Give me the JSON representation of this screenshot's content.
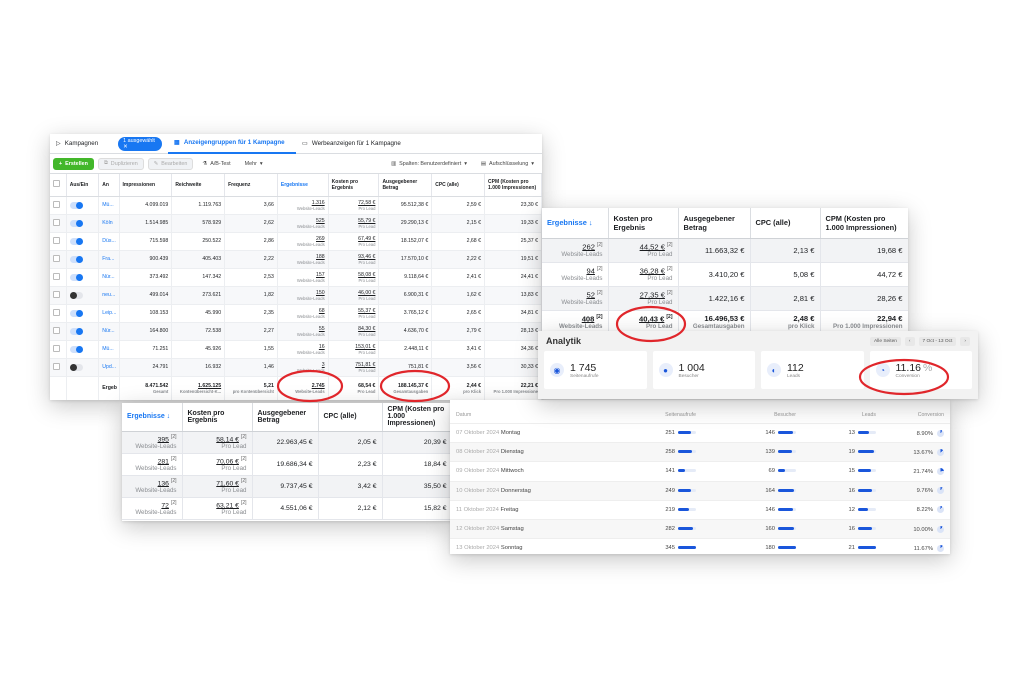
{
  "p1": {
    "tabs": {
      "campaigns": "Kampagnen",
      "selected": "1 ausgewählt",
      "adsets": "Anzeigengruppen für 1 Kampagne",
      "ads": "Werbeanzeigen für 1 Kampagne"
    },
    "toolbar": {
      "create": "Erstellen",
      "duplicate": "Duplizieren",
      "edit": "Bearbeiten",
      "abtest": "A/B-Test",
      "more": "Mehr",
      "columns": "Spalten: Benutzerdefiniert",
      "breakdown": "Aufschlüsselung"
    },
    "headers": [
      "Aus/Ein",
      "An",
      "Impressionen",
      "Reichweite",
      "Frequenz",
      "Ergebnisse",
      "Kosten pro Ergebnis",
      "Ausgegebener Betrag",
      "CPC (alle)",
      "CPM (Kosten pro 1.000 Impressionen)"
    ],
    "result_sub": "Website-Leads",
    "cost_sub": "Pro Lead",
    "rows": [
      {
        "toggle": "on",
        "name": "Mü...",
        "impr": "4.099.019",
        "reach": "1.119.763",
        "freq": "3,66",
        "res": "1.316",
        "cpr": "72,58 €",
        "spend": "95.512,38 €",
        "cpc": "2,59 €",
        "cpm": "23,30 €"
      },
      {
        "toggle": "on",
        "name": "Köln",
        "impr": "1.514.985",
        "reach": "578.929",
        "freq": "2,62",
        "res": "525",
        "cpr": "55,79 €",
        "spend": "29.290,13 €",
        "cpc": "2,15 €",
        "cpm": "19,33 €"
      },
      {
        "toggle": "on",
        "name": "Düs...",
        "impr": "715.598",
        "reach": "250.522",
        "freq": "2,86",
        "res": "269",
        "cpr": "67,49 €",
        "spend": "18.152,07 €",
        "cpc": "2,68 €",
        "cpm": "25,37 €"
      },
      {
        "toggle": "on",
        "name": "Fra...",
        "impr": "900.439",
        "reach": "405.403",
        "freq": "2,22",
        "res": "188",
        "cpr": "93,46 €",
        "spend": "17.570,10 €",
        "cpc": "2,22 €",
        "cpm": "19,51 €"
      },
      {
        "toggle": "on",
        "name": "Nür...",
        "impr": "373.492",
        "reach": "147.342",
        "freq": "2,53",
        "res": "157",
        "cpr": "58,08 €",
        "spend": "9.118,64 €",
        "cpc": "2,41 €",
        "cpm": "24,41 €"
      },
      {
        "toggle": "off",
        "name": "neu...",
        "impr": "499.014",
        "reach": "273.621",
        "freq": "1,82",
        "res": "150",
        "cpr": "46,00 €",
        "spend": "6.900,31 €",
        "cpc": "1,62 €",
        "cpm": "13,83 €"
      },
      {
        "toggle": "on",
        "name": "Leip...",
        "impr": "108.153",
        "reach": "45.990",
        "freq": "2,35",
        "res": "68",
        "cpr": "55,37 €",
        "spend": "3.765,12 €",
        "cpc": "2,65 €",
        "cpm": "34,81 €"
      },
      {
        "toggle": "on",
        "name": "Nür...",
        "impr": "164.800",
        "reach": "72.538",
        "freq": "2,27",
        "res": "55",
        "cpr": "84,30 €",
        "spend": "4.636,70 €",
        "cpc": "2,79 €",
        "cpm": "28,13 €"
      },
      {
        "toggle": "on",
        "name": "Mü...",
        "impr": "71.251",
        "reach": "45.926",
        "freq": "1,55",
        "res": "16",
        "cpr": "153,01 €",
        "spend": "2.448,11 €",
        "cpc": "3,41 €",
        "cpm": "34,36 €"
      },
      {
        "toggle": "off",
        "name": "Upd...",
        "impr": "24.791",
        "reach": "16.932",
        "freq": "1,46",
        "res": "3",
        "cpr": "751,81 €",
        "spend": "751,81 €",
        "cpc": "3,56 €",
        "cpm": "30,33 €"
      }
    ],
    "total": {
      "label": "Ergeb",
      "impr": "8.471.542",
      "impr_sub": "Gesamt",
      "reach": "1.625.125",
      "reach_sub": "Kontenübersicht-K...",
      "freq": "5,21",
      "freq_sub": "pro Kontenübersicht",
      "res": "2.745",
      "res_sub": "Website-Leads",
      "cpr": "68,54 €",
      "cpr_sub": "Pro Lead",
      "spend": "188.145,37 €",
      "spend_sub": "Gesamtausgaben",
      "cpc": "2,44 €",
      "cpc_sub": "pro Klick",
      "cpm": "22,21 €",
      "cpm_sub": "Pro 1.000 Impressione"
    }
  },
  "p2": {
    "headers": [
      "Ergebnisse ↓",
      "Kosten pro Ergebnis",
      "Ausgegebener Betrag",
      "CPC (alle)",
      "CPM (Kosten pro 1.000 Impressionen)"
    ],
    "rows": [
      {
        "res": "262",
        "cpr": "44,52 €",
        "spend": "11.663,32 €",
        "cpc": "2,13 €",
        "cpm": "19,68 €"
      },
      {
        "res": "94",
        "cpr": "36,28 €",
        "spend": "3.410,20 €",
        "cpc": "5,08 €",
        "cpm": "44,72 €"
      },
      {
        "res": "52",
        "cpr": "27,35 €",
        "spend": "1.422,16 €",
        "cpc": "2,81 €",
        "cpm": "28,26 €"
      }
    ],
    "total": {
      "res": "408",
      "cpr": "40,43 €",
      "spend": "16.496,53 €",
      "spend_sub": "Gesamtausgaben",
      "cpc": "2,48 €",
      "cpc_sub": "pro Klick",
      "cpm": "22,94 €",
      "cpm_sub": "Pro 1.000 Impressionen"
    },
    "note": "[2]",
    "res_sub": "Website-Leads",
    "cost_sub": "Pro Lead"
  },
  "p3": {
    "headers": [
      "Ergebnisse ↓",
      "Kosten pro Ergebnis",
      "Ausgegebener Betrag",
      "CPC (alle)",
      "CPM (Kosten pro 1.000 Impressionen)"
    ],
    "rows": [
      {
        "res": "395",
        "cpr": "58,14 €",
        "spend": "22.963,45 €",
        "cpc": "2,05 €",
        "cpm": "20,39 €"
      },
      {
        "res": "281",
        "cpr": "70,06 €",
        "spend": "19.686,34 €",
        "cpc": "2,23 €",
        "cpm": "18,84 €"
      },
      {
        "res": "136",
        "cpr": "71,60 €",
        "spend": "9.737,45 €",
        "cpc": "3,42 €",
        "cpm": "35,50 €"
      },
      {
        "res": "72",
        "cpr": "63,21 €",
        "spend": "4.551,06 €",
        "cpc": "2,12 €",
        "cpm": "15,82 €"
      }
    ],
    "note": "[2]",
    "res_sub": "Website-Leads",
    "cost_sub": "Pro Lead"
  },
  "analytics": {
    "title": "Analytik",
    "all_pages": "Alle Seiten",
    "prev": "‹",
    "range": "7 Oct - 13 Oct",
    "next": "›",
    "stats": [
      {
        "icon": "eye-icon",
        "glyph": "◉",
        "value": "1 745",
        "label": "Seitenaufrufe"
      },
      {
        "icon": "user-icon",
        "glyph": "●",
        "value": "1 004",
        "label": "Besucher"
      },
      {
        "icon": "leads-icon",
        "glyph": "◐",
        "value": "112",
        "label": "Leads"
      },
      {
        "icon": "conversion-pie-icon",
        "glyph": "◔",
        "value": "11.16",
        "unit": "%",
        "label": "Conversion"
      }
    ]
  },
  "daily": {
    "headers": [
      "Datum",
      "Seitenaufrufe",
      "Besucher",
      "Leads",
      "Conversion"
    ],
    "month": "Oktober",
    "year": "2024",
    "rows": [
      {
        "day": "07",
        "weekday": "Montag",
        "views": "251",
        "views_frac": 0.73,
        "visitors": "146",
        "visitors_frac": 0.81,
        "leads": "13",
        "leads_frac": 0.62,
        "conv": "8.90%"
      },
      {
        "day": "08",
        "weekday": "Dienstag",
        "views": "258",
        "views_frac": 0.75,
        "visitors": "139",
        "visitors_frac": 0.77,
        "leads": "19",
        "leads_frac": 0.9,
        "conv": "13.67%"
      },
      {
        "day": "09",
        "weekday": "Mittwoch",
        "views": "141",
        "views_frac": 0.41,
        "visitors": "69",
        "visitors_frac": 0.38,
        "leads": "15",
        "leads_frac": 0.71,
        "conv": "21.74%"
      },
      {
        "day": "10",
        "weekday": "Donnerstag",
        "views": "249",
        "views_frac": 0.72,
        "visitors": "164",
        "visitors_frac": 0.91,
        "leads": "16",
        "leads_frac": 0.76,
        "conv": "9.76%"
      },
      {
        "day": "11",
        "weekday": "Freitag",
        "views": "219",
        "views_frac": 0.63,
        "visitors": "146",
        "visitors_frac": 0.81,
        "leads": "12",
        "leads_frac": 0.57,
        "conv": "8.22%"
      },
      {
        "day": "12",
        "weekday": "Samstag",
        "views": "282",
        "visitors": "160",
        "leads": "16",
        "views_frac": 0.82,
        "visitors_frac": 0.89,
        "leads_frac": 0.76,
        "conv": "10.00%"
      },
      {
        "day": "13",
        "weekday": "Sonntag",
        "views": "345",
        "views_frac": 1.0,
        "visitors": "180",
        "visitors_frac": 1.0,
        "leads": "21",
        "leads_frac": 1.0,
        "conv": "11.67%"
      }
    ]
  },
  "highlight_color": "#e0262b"
}
